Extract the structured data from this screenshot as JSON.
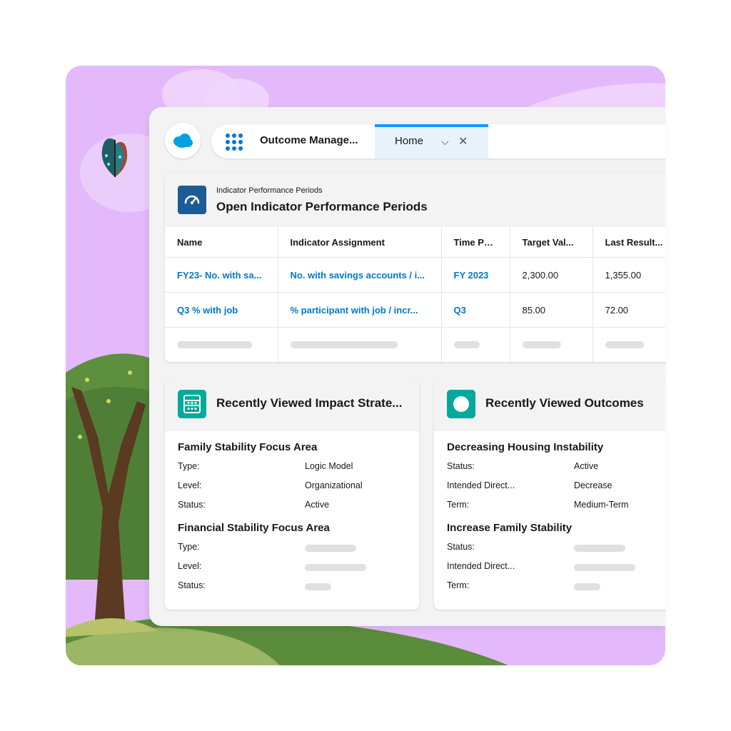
{
  "colors": {
    "brand_blue": "#0176d3",
    "tab_accent": "#1b96ff",
    "periods_icon": "#1d5b97",
    "teal_icon": "#04a99b",
    "scene_background": "#e4b9fb"
  },
  "icons": {
    "logo": "salesforce-cloud-icon",
    "launcher": "app-launcher-grid-icon",
    "periods": "speedometer-icon",
    "strategies": "impact-strategy-icon",
    "outcomes": "outcome-circle-icon"
  },
  "navbar": {
    "app_name": "Outcome Manage...",
    "tab_label": "Home",
    "tab_dropdown_glyph": "⌵",
    "tab_close_glyph": "✕"
  },
  "periods_card": {
    "object_label": "Indicator Performance Periods",
    "title": "Open Indicator Performance Periods",
    "columns": [
      "Name",
      "Indicator Assignment",
      "Time Per...",
      "Target Val...",
      "Last Result..."
    ],
    "rows": [
      [
        "FY23- No. with sa...",
        "No. with savings accounts / i...",
        "FY 2023",
        "2,300.00",
        "1,355.00"
      ],
      [
        "Q3 % with job",
        "% participant with job / incr...",
        "Q3",
        "85.00",
        "72.00"
      ]
    ]
  },
  "strategies_card": {
    "title": "Recently Viewed Impact Strate...",
    "records": [
      {
        "name": "Family Stability Focus Area",
        "fields": [
          {
            "label": "Type:",
            "value": "Logic Model"
          },
          {
            "label": "Level:",
            "value": "Organizational"
          },
          {
            "label": "Status:",
            "value": "Active"
          }
        ]
      },
      {
        "name": "Financial Stability Focus Area",
        "fields": [
          {
            "label": "Type:",
            "value": ""
          },
          {
            "label": "Level:",
            "value": ""
          },
          {
            "label": "Status:",
            "value": ""
          }
        ]
      }
    ]
  },
  "outcomes_card": {
    "title": "Recently Viewed Outcomes",
    "records": [
      {
        "name": "Decreasing Housing Instability",
        "fields": [
          {
            "label": "Status:",
            "value": "Active"
          },
          {
            "label": "Intended Direct...",
            "value": "Decrease"
          },
          {
            "label": "Term:",
            "value": "Medium-Term"
          }
        ]
      },
      {
        "name": "Increase Family Stability",
        "fields": [
          {
            "label": "Status:",
            "value": ""
          },
          {
            "label": "Intended Direct...",
            "value": ""
          },
          {
            "label": "Term:",
            "value": ""
          }
        ]
      }
    ]
  }
}
